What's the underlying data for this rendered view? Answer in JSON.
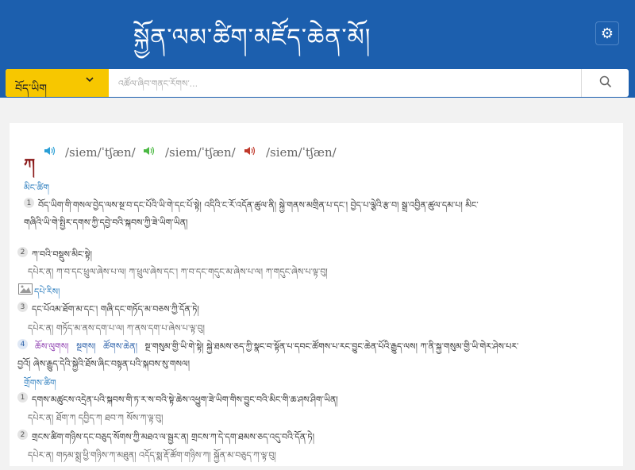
{
  "header": {
    "title": "སྐྱོན་ལམ་ཚིག་མཛོད་ཆེན་མོ།",
    "settings_icon": "gear-icon"
  },
  "search": {
    "language_selected": "བོད་ཡིག",
    "placeholder": "འཚོལ་ཞིབ་གནང་རོགས་...",
    "search_icon": "magnifier-icon"
  },
  "colors": {
    "header_bg": "#1c5fae",
    "lang_bg": "#f7c700",
    "headword": "#8b1a1a",
    "section_label": "#2f7fbf",
    "speaker_1": "#2a9fd6",
    "speaker_2": "#4cb944",
    "speaker_3": "#c0392b"
  },
  "entry": {
    "headword": "ཀ",
    "pronunciations": [
      "/siem/ˈtʃæn/",
      "/siem/ˈtʃæn/",
      "/siem/ˈtʃæn/"
    ],
    "sections": [
      {
        "label": "མིང་ཚིག",
        "senses": [
          {
            "num": "1",
            "lines": [
              "བོད་ཡིག་གི་གསལ་བྱེད་ལས་སྔ་བ་དང་པོའི་ཡི་གེ་དང་པོ་སྟེ། འདིའི་ང་རོ་འདོན་ཚུལ་ནི། སྐྱེ་གནས་མགྲིན་པ་དང་། བྱེད་པ་ལྕེའི་རྩ་བ། སྒྲ་འབྱིན་ཚུལ་དམ་པ། མིང་",
              "གཞིའི་ཡི་གེ་སྤྱིར་དགས་ཀྱི་དབྱེ་བའི་སྐབས་ཀྱི་ཟེ་ཡིག་ཡིན།"
            ],
            "example": ""
          },
          {
            "num": "2",
            "lines": [
              "ཀ་བའི་བསྡུས་མིང་སྟེ།"
            ],
            "example": "དཔེར་ན། ཀ་བ་དང་ཕྲུལ་ཞེས་པ་ལ། ཀ་ཕྲུལ་ཞེས་དང་། ཀ་བ་དང་གདུང་མ་ཞེས་པ་ལ། ཀ་གདུང་ཞེས་པ་ལྟ་བུ།"
          },
          {
            "num": "3",
            "lines": [
              "དང་པོའམ་ཐོག་མ་དང་། གཞི་དང་གཏོད་མ་བཅས་ཀྱི་དོན་ཏེ།"
            ],
            "example": "དཔེར་ན། གཏོད་མ་ནས་དག་པ་ལ། ཀ་ནས་དག་པ་ཞེས་པ་ལྟ་བུ།",
            "pre_label": "དཔེ་རིས།"
          },
          {
            "num": "4",
            "tags": [
              "ཆོས་ལུགས།",
              "སྔགས།",
              "ཚོགས་ཆེན།"
            ],
            "lines": [
              "སྔ་གསུམ་གྱི་ཡི་གེ་སྟེ། སྐྱེ་ཐམས་ཅད་ཀྱི་སྣང་བ་སྟོན་པ་དབང་ཚོགས་པ་རང་བྱུང་ཆེན་པོའི་རྒྱུད་ལས། ཀ་ནི་སྐྱ་གསུམ་གྱི་ཡི་གེར་ཤེས་པར་",
              "བྱའོ། ཞེས་རྒྱུད་དེའི་སྐྱེའི་ཐོས་ཞིང་བསྟན་པའི་སྐབས་སུ་གསལ།"
            ],
            "example": ""
          }
        ]
      },
      {
        "label": "གྲོགས་ཚིག",
        "senses": [
          {
            "num": "1",
            "lines": [
              "དགས་མཚུངས་འདྲེན་པའི་སྐབས་གི་ཏ་ར་ས་བའི་སྟེ་ཆེས་འཕྱུག་ཟེ་ཡིག་གིས་བྱུང་བའི་མིང་གི་ཆ་ཤས་ཤིག་ཡིན།"
            ],
            "example": "དཔེར་ན། ཐོག་ཀ དབྱིད་ཀ ཐབ་ཀ སོས་ཀ་ལྟ་བུ།"
          },
          {
            "num": "2",
            "lines": [
              "གྲངས་ཚིག་གཉིས་དང་བཅུད་སོགས་ཀྱི་མཐའ་ལ་སྦྱར་ན། གྲངས་ཀ་དེ་དག་ཐམས་ཅད་འདུ་བའི་དོན་ཏེ།"
            ],
            "example": "དཔེར་ན། གཏམ་སྨྲ་ཕྱི་གཉིས་ཀ་མཐུན། འདོད་སྨ་རྡོ་ཚོག་གཉིས་ཀ། སྐྱོན་མ་བཅུད་ཀ་ལྟ་བུ།"
          }
        ]
      }
    ]
  }
}
